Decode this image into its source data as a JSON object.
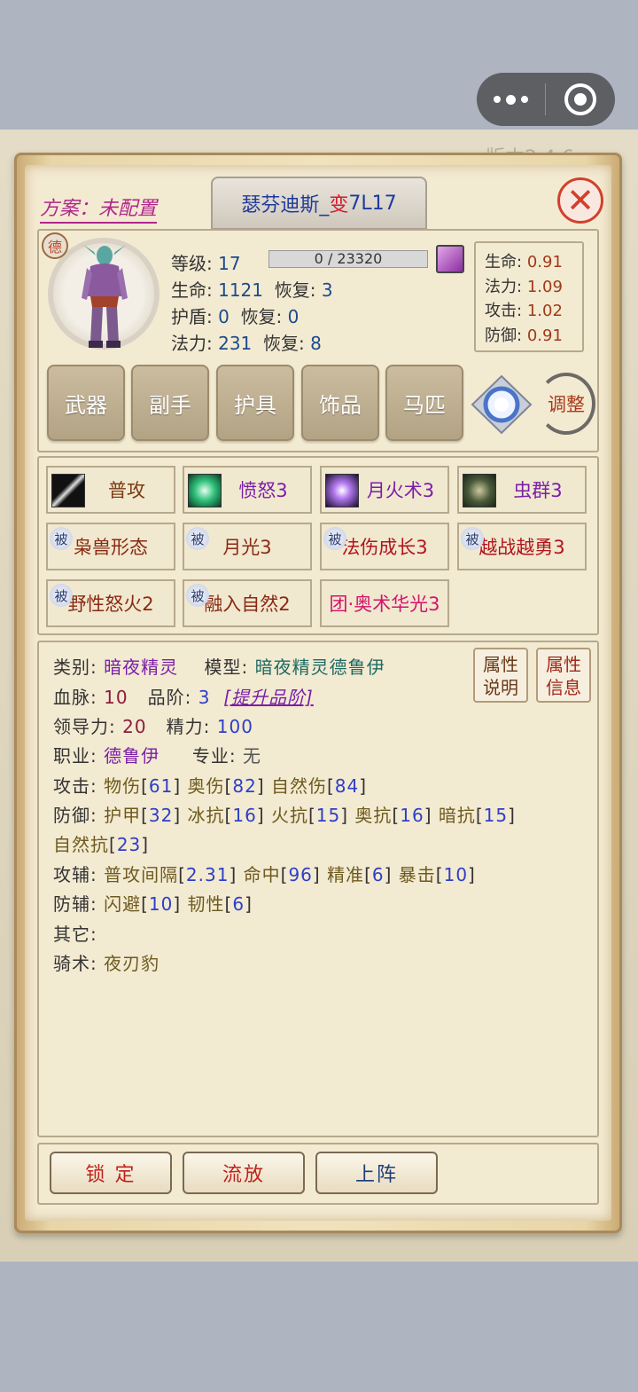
{
  "capsule": {
    "more_icon": "more-dots-icon",
    "target_icon": "target-circle-icon"
  },
  "plan_label": "方案：未配置",
  "hero": {
    "name_prefix": "瑟芬迪斯_",
    "name_variant": "变",
    "name_suffix": "7L17"
  },
  "close_icon": "close-x-icon",
  "portrait": {
    "badge": "德",
    "icon": "night-elf-druid-figure"
  },
  "stats": {
    "level_label": "等级:",
    "level": "17",
    "exp": "0 / 23320",
    "hp_label": "生命:",
    "hp": "1121",
    "hp_regen_label": "恢复:",
    "hp_regen": "3",
    "shield_label": "护盾:",
    "shield": "0",
    "shield_regen_label": "恢复:",
    "shield_regen": "0",
    "mp_label": "法力:",
    "mp": "231",
    "mp_regen_label": "恢复:",
    "mp_regen": "8"
  },
  "ratios": [
    {
      "label": "生命:",
      "value": "0.91"
    },
    {
      "label": "法力:",
      "value": "1.09"
    },
    {
      "label": "攻击:",
      "value": "1.02"
    },
    {
      "label": "防御:",
      "value": "0.91"
    }
  ],
  "equipment": [
    "武器",
    "副手",
    "护具",
    "饰品",
    "马匹"
  ],
  "adjust_label": "调整",
  "skills": [
    {
      "label": "普攻",
      "passive": false
    },
    {
      "label": "愤怒3",
      "passive": false
    },
    {
      "label": "月火术3",
      "passive": false
    },
    {
      "label": "虫群3",
      "passive": false
    },
    {
      "label": "枭兽形态",
      "passive": true
    },
    {
      "label": "月光3",
      "passive": true
    },
    {
      "label": "法伤成长3",
      "passive": true
    },
    {
      "label": "越战越勇3",
      "passive": true
    },
    {
      "label": "野性怒火2",
      "passive": true
    },
    {
      "label": "融入自然2",
      "passive": true
    },
    {
      "label": "团·奥术华光3",
      "passive": false
    }
  ],
  "passive_mark": "被",
  "info": {
    "category_label": "类别:",
    "category": "暗夜精灵",
    "model_label": "模型:",
    "model": "暗夜精灵德鲁伊",
    "bloodline_label": "血脉:",
    "bloodline": "10",
    "grade_label": "品阶:",
    "grade": "3",
    "upgrade_link": "[提升品阶]",
    "leadership_label": "领导力:",
    "leadership": "20",
    "energy_label": "精力:",
    "energy": "100",
    "job_label": "职业:",
    "job": "德鲁伊",
    "spec_label": "专业:",
    "spec": "无",
    "attack_label": "攻击:",
    "attack": [
      {
        "name": "物伤",
        "value": "61"
      },
      {
        "name": "奥伤",
        "value": "82"
      },
      {
        "name": "自然伤",
        "value": "84"
      }
    ],
    "defense_label": "防御:",
    "defense": [
      {
        "name": "护甲",
        "value": "32"
      },
      {
        "name": "冰抗",
        "value": "16"
      },
      {
        "name": "火抗",
        "value": "15"
      },
      {
        "name": "奥抗",
        "value": "16"
      },
      {
        "name": "暗抗",
        "value": "15"
      },
      {
        "name": "自然抗",
        "value": "23"
      }
    ],
    "atk_aux_label": "攻辅:",
    "atk_aux": [
      {
        "name": "普攻间隔",
        "value": "2.31"
      },
      {
        "name": "命中",
        "value": "96"
      },
      {
        "name": "精准",
        "value": "6"
      },
      {
        "name": "暴击",
        "value": "10"
      }
    ],
    "def_aux_label": "防辅:",
    "def_aux": [
      {
        "name": "闪避",
        "value": "10"
      },
      {
        "name": "韧性",
        "value": "6"
      }
    ],
    "other_label": "其它:",
    "riding_label": "骑术:",
    "riding": "夜刃豹"
  },
  "attr_buttons": {
    "explain": [
      "属性",
      "说明"
    ],
    "info": [
      "属性",
      "信息"
    ]
  },
  "bottom_buttons": {
    "lock": "锁 定",
    "exile": "流放",
    "deploy": "上阵"
  },
  "version_text": "版本2.4.6"
}
